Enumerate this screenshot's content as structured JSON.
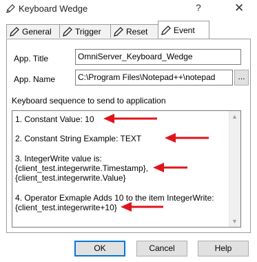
{
  "window": {
    "title": "Keyboard Wedge",
    "help_glyph": "?",
    "close_glyph": "✕"
  },
  "tabs": [
    {
      "label": "General",
      "icon": "pencil-icon",
      "active": false
    },
    {
      "label": "Trigger",
      "icon": "pencil-icon",
      "active": false
    },
    {
      "label": "Reset",
      "icon": "pencil-icon",
      "active": false
    },
    {
      "label": "Event",
      "icon": "pencil-icon",
      "active": true
    }
  ],
  "form": {
    "app_title_label": "App. Title",
    "app_title_value": "OmniServer_Keyboard_Wedge",
    "app_name_label": "App. Name",
    "app_name_value": "C:\\Program Files\\Notepad++\\notepad",
    "browse_label": "...",
    "sequence_label": "Keyboard sequence to send to application"
  },
  "sequence_lines": [
    "1. Constant Value: 10",
    "2. Constant String Example: TEXT",
    "3. IntegerWrite value is:",
    "{client_test.integerwrite.Timestamp},",
    "{client_test.integerwrite.Value}",
    "4. Operator Exmaple Adds 10 to the item IntegerWrite:",
    "{client_test.integerwrite+10}"
  ],
  "buttons": {
    "ok": "OK",
    "cancel": "Cancel",
    "help": "Help"
  },
  "colors": {
    "annotation_arrow": "#e0141e",
    "default_button_border": "#0078d7"
  }
}
